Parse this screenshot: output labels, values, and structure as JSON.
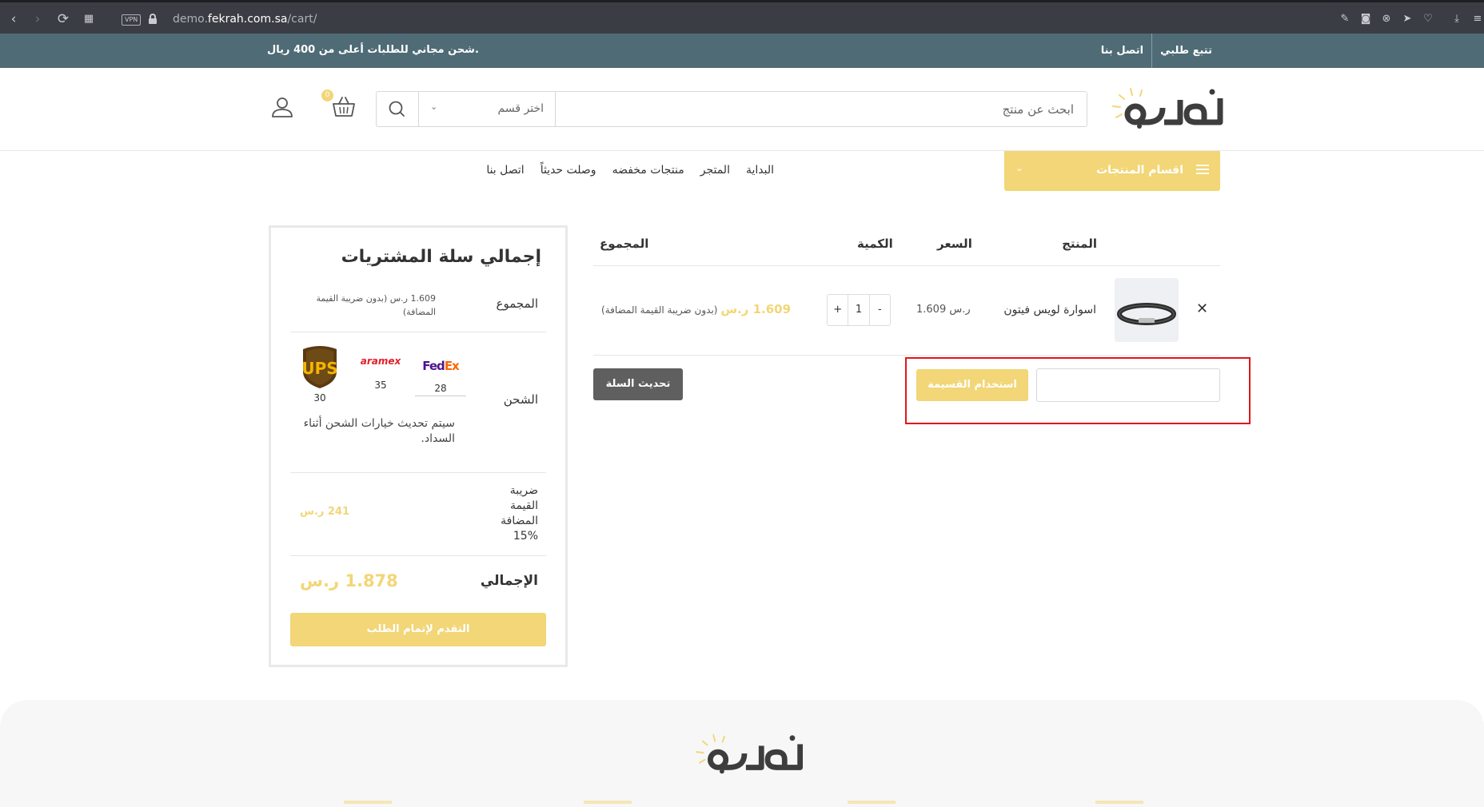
{
  "browser": {
    "vpn_label": "VPN",
    "url_prefix": "demo.",
    "url_domain": "fekrah.com.sa",
    "url_path": "/cart/"
  },
  "topbar": {
    "free_shipping": "شحن مجاني للطلبات أعلى من 400 ريال.",
    "track_order": "تتبع طلبي",
    "contact_us": "اتصل بنا"
  },
  "header": {
    "search_placeholder": "ابحث عن منتج",
    "category_select": "اختر قسم",
    "cart_count": "0"
  },
  "nav": {
    "categories_button": "اقسام المنتجات",
    "links": [
      "البداية",
      "المتجر",
      "منتجات مخفضه",
      "وصلت حديثاً",
      "اتصل بنا"
    ]
  },
  "cart": {
    "headers": {
      "product": "المنتج",
      "price": "السعر",
      "quantity": "الكمية",
      "total": "المجموع"
    },
    "item": {
      "name": "اسوارة لويس فيتون",
      "price": "1.609 ر.س",
      "quantity": "1",
      "total_amount": "1.609 ر.س",
      "total_tax_note": "(بدون ضريبة القيمة المضافة)"
    },
    "qty_plus": "+",
    "qty_minus": "-",
    "apply_coupon": "استخدام القسيمة",
    "update_cart": "تحديث السلة"
  },
  "totals": {
    "title": "إجمالي سلة المشتريات",
    "subtotal_label": "المجموع",
    "subtotal_value": "1.609 ر.س (بدون ضريبة القيمة المضافة)",
    "shipping_label": "الشحن",
    "carriers": [
      {
        "name": "UPS",
        "price": "30"
      },
      {
        "name": "aramex",
        "price": "35"
      },
      {
        "name": "FedEx",
        "price": "28"
      }
    ],
    "shipping_note": "سيتم تحديث خيارات الشحن أثناء السداد.",
    "vat_label": "ضريبة القيمة المضافة %15",
    "vat_value": "241 ر.س",
    "grand_total_label": "الإجمالي",
    "grand_total_value": "1.878 ر.س",
    "checkout": "التقدم لإتمام الطلب"
  },
  "colors": {
    "brand_yellow": "#f2d677",
    "topbar": "#4e6b76",
    "coupon_highlight": "#e0161b",
    "update_button": "#5f5f5f"
  }
}
